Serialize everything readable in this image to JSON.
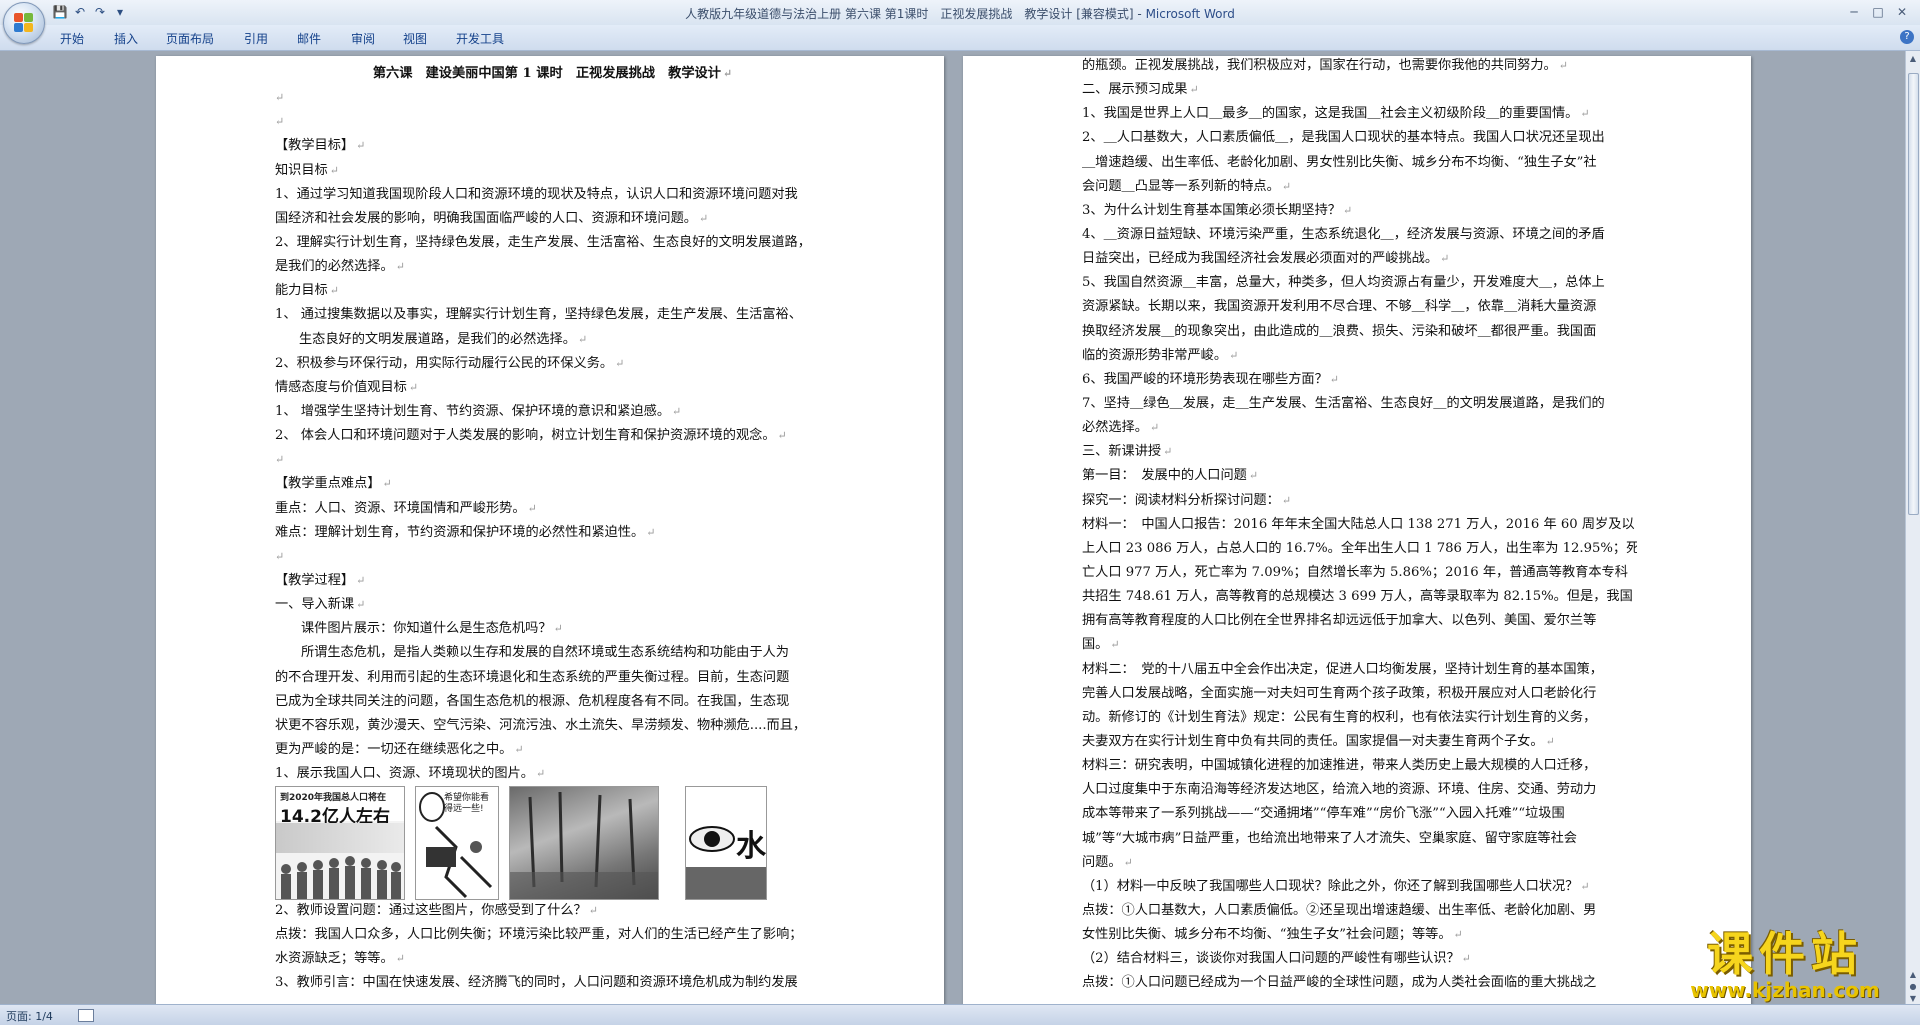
{
  "window": {
    "title": "人教版九年级道德与法治上册 第六课 第1课时　正视发展挑战　教学设计 [兼容模式] - ",
    "app_name": "Microsoft Word",
    "minimize": "─",
    "maximize": "□",
    "close": "✕"
  },
  "quick_access": {
    "save": "💾",
    "undo": "↶",
    "redo": "↷",
    "more": "▾"
  },
  "ribbon": {
    "tabs": [
      "开始",
      "插入",
      "页面布局",
      "引用",
      "邮件",
      "审阅",
      "视图",
      "开发工具"
    ],
    "help": "?"
  },
  "page1": {
    "lines": [
      "第六课　建设美丽中国第 1 课时　正视发展挑战　教学设计",
      "",
      "",
      "【教学目标】",
      "知识目标",
      "1、通过学习知道我国现阶段人口和资源环境的现状及特点，认识人口和资源环境问题对我",
      "国经济和社会发展的影响，明确我国面临严峻的人口、资源和环境问题。",
      "2、理解实行计划生育，坚持绿色发展，走生产发展、生活富裕、生态良好的文明发展道路，",
      "是我们的必然选择。",
      "能力目标",
      "1、 通过搜集数据以及事实，理解实行计划生育，坚持绿色发展，走生产发展、生活富裕、",
      "生态良好的文明发展道路，是我们的必然选择。",
      "2、积极参与环保行动，用实际行动履行公民的环保义务。",
      "情感态度与价值观目标",
      "1、 增强学生坚持计划生育、节约资源、保护环境的意识和紧迫感。",
      "2、 体会人口和环境问题对于人类发展的影响，树立计划生育和保护资源环境的观念。",
      "",
      "【教学重点难点】",
      "重点：人口、资源、环境国情和严峻形势。",
      "难点：理解计划生育，节约资源和保护环境的必然性和紧迫性。",
      "",
      "【教学过程】",
      "一、导入新课",
      "课件图片展示：你知道什么是生态危机吗？",
      "所谓生态危机，是指人类赖以生存和发展的自然环境或生态系统结构和功能由于人为",
      "的不合理开发、利用而引起的生态环境退化和生态系统的严重失衡过程。目前，生态问题",
      "已成为全球共同关注的问题，各国生态危机的根源、危机程度各有不同。在我国，生态现",
      "状更不容乐观，黄沙漫天、空气污染、河流污浊、水土流失、旱涝频发、物种濒危....而且，",
      "更为严峻的是：一切还在继续恶化之中。",
      "1、展示我国人口、资源、环境现状的图片。"
    ],
    "after_pics": [
      "2、教师设置问题：通过这些图片，你感受到了什么？",
      "点拨：我国人口众多，人口比例失衡；环境污染比较严重，对人们的生活已经产生了影响；",
      "水资源缺乏；等等。",
      "3、教师引言：中国在快速发展、经济腾飞的同时，人口问题和资源环境危机成为制约发展"
    ],
    "images": {
      "poster_title": "到2020年我国总人口将在",
      "poster_big": "14.2亿人左右",
      "cartoon_text": "希望你能看得远一些!",
      "eye_text": "水"
    }
  },
  "page2": {
    "lines": [
      "的瓶颈。正视发展挑战，我们积极应对，国家在行动，也需要你我他的共同努力。",
      "二、展示预习成果",
      "1、我国是世界上人口＿最多＿的国家，这是我国＿社会主义初级阶段＿的重要国情。",
      "2、＿人口基数大，人口素质偏低＿，是我国人口现状的基本特点。我国人口状况还呈现出",
      "＿增速趋缓、出生率低、老龄化加剧、男女性别比失衡、城乡分布不均衡、“独生子女”社",
      "会问题＿凸显等一系列新的特点。",
      "3、为什么计划生育基本国策必须长期坚持？",
      "4、＿资源日益短缺、环境污染严重，生态系统退化＿，经济发展与资源、环境之间的矛盾",
      "日益突出，已经成为我国经济社会发展必须面对的严峻挑战。",
      "5、我国自然资源＿丰富，总量大，种类多，但人均资源占有量少，开发难度大＿，总体上",
      "资源紧缺。长期以来，我国资源开发利用不尽合理、不够＿科学＿，依靠＿消耗大量资源",
      "换取经济发展＿的现象突出，由此造成的＿浪费、损失、污染和破坏＿都很严重。我国面",
      "临的资源形势非常严峻。",
      "6、我国严峻的环境形势表现在哪些方面？",
      "7、坚持＿绿色＿发展，走＿生产发展、生活富裕、生态良好＿的文明发展道路，是我们的",
      "必然选择。",
      "三、新课讲授",
      "第一目：　发展中的人口问题",
      "探究一：阅读材料分析探讨问题：",
      "材料一：　中国人口报告：2016 年年末全国大陆总人口 138 271 万人，2016 年 60 周岁及以",
      "上人口 23 086 万人，占总人口的 16.7%。全年出生人口 1 786 万人，出生率为 12.95%；死",
      "亡人口 977 万人，死亡率为 7.09%；自然增长率为 5.86%；2016 年，普通高等教育本专科",
      "共招生 748.61 万人，高等教育的总规模达 3 699 万人，高等录取率为 82.15%。但是，我国",
      "拥有高等教育程度的人口比例在全世界排名却远远低于加拿大、以色列、美国、爱尔兰等",
      "国。",
      "材料二：　党的十八届五中全会作出决定，促进人口均衡发展，坚持计划生育的基本国策，",
      "完善人口发展战略，全面实施一对夫妇可生育两个孩子政策，积极开展应对人口老龄化行",
      "动。新修订的《计划生育法》规定：公民有生育的权利，也有依法实行计划生育的义务，",
      "夫妻双方在实行计划生育中负有共同的责任。国家提倡一对夫妻生育两个子女。",
      "材料三：研究表明，中国城镇化进程的加速推进，带来人类历史上最大规模的人口迁移，",
      "人口过度集中于东南沿海等经济发达地区，给流入地的资源、环境、住房、交通、劳动力",
      "成本等带来了一系列挑战——“交通拥堵”“停车难”“房价飞涨”“入园入托难”“垃圾围",
      "城”等“大城市病”日益严重，也给流出地带来了人才流失、空巢家庭、留守家庭等社会",
      "问题。",
      "（1）材料一中反映了我国哪些人口现状？除此之外，你还了解到我国哪些人口状况？",
      "点拨：①人口基数大，人口素质偏低。②还呈现出增速趋缓、出生率低、老龄化加剧、男",
      "女性别比失衡、城乡分布不均衡、“独生子女”社会问题；等等。",
      "（2）结合材料三，谈谈你对我国人口问题的严峻性有哪些认识？",
      "点拨：①人口问题已经成为一个日益严峻的全球性问题，成为人类社会面临的重大挑战之"
    ]
  },
  "status": {
    "page": "页面: 1/4"
  },
  "watermark": {
    "main": "课件站",
    "url": "www.kjzhan.com"
  },
  "colors": {
    "accent": "#15428b",
    "watermark": "#f6d51d",
    "workspace": "#9ea8b5"
  }
}
